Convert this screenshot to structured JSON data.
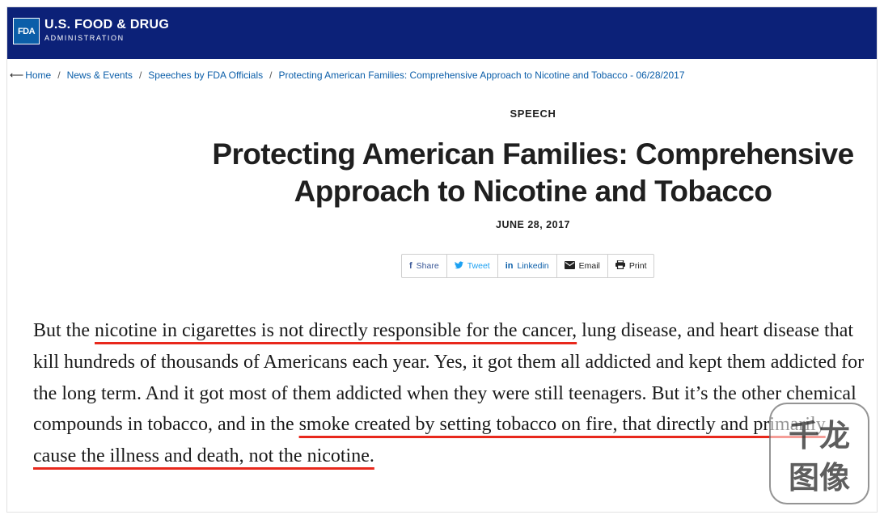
{
  "header": {
    "logo_text": "FDA",
    "org_name": "U.S. FOOD & DRUG",
    "org_sub": "ADMINISTRATION",
    "bg_color": "#0c2178"
  },
  "breadcrumb": {
    "back_arrow": "⟵",
    "items": [
      "Home",
      "News & Events",
      "Speeches by FDA Officials",
      "Protecting American Families: Comprehensive Approach to Nicotine and Tobacco - 06/28/2017"
    ]
  },
  "article": {
    "kicker": "SPEECH",
    "title_line1": "Protecting American Families: Comprehensive",
    "title_line2": "Approach to Nicotine and Tobacco",
    "date": "JUNE 28, 2017"
  },
  "share": {
    "buttons": [
      {
        "icon": "facebook-icon",
        "glyph": "f",
        "label": "Share"
      },
      {
        "icon": "twitter-icon",
        "glyph": "🐦",
        "label": "Tweet"
      },
      {
        "icon": "linkedin-icon",
        "glyph": "in",
        "label": "Linkedin"
      },
      {
        "icon": "envelope-icon",
        "glyph": "✉",
        "label": "Email"
      },
      {
        "icon": "printer-icon",
        "glyph": "⎙",
        "label": "Print"
      }
    ]
  },
  "quote": {
    "seg1": "But the ",
    "seg2": "nicotine in cigarettes is not directly responsible for the cancer,",
    "seg3": " lung disease, and heart disease that kill hundreds of thousands of Americans each year.  Yes, it got them all addicted and kept them addicted for the long term.  And it got most of them addicted when they were still teenagers.  But it’s the other chemical compounds in tobacco, and in the ",
    "seg4": "smoke created by setting tobacco on fire, that directly and primarily cause the illness and death, not the nicotine.",
    "underline_color": "#e8281c"
  },
  "watermark": {
    "line1": "千龙",
    "line2": "图像"
  }
}
